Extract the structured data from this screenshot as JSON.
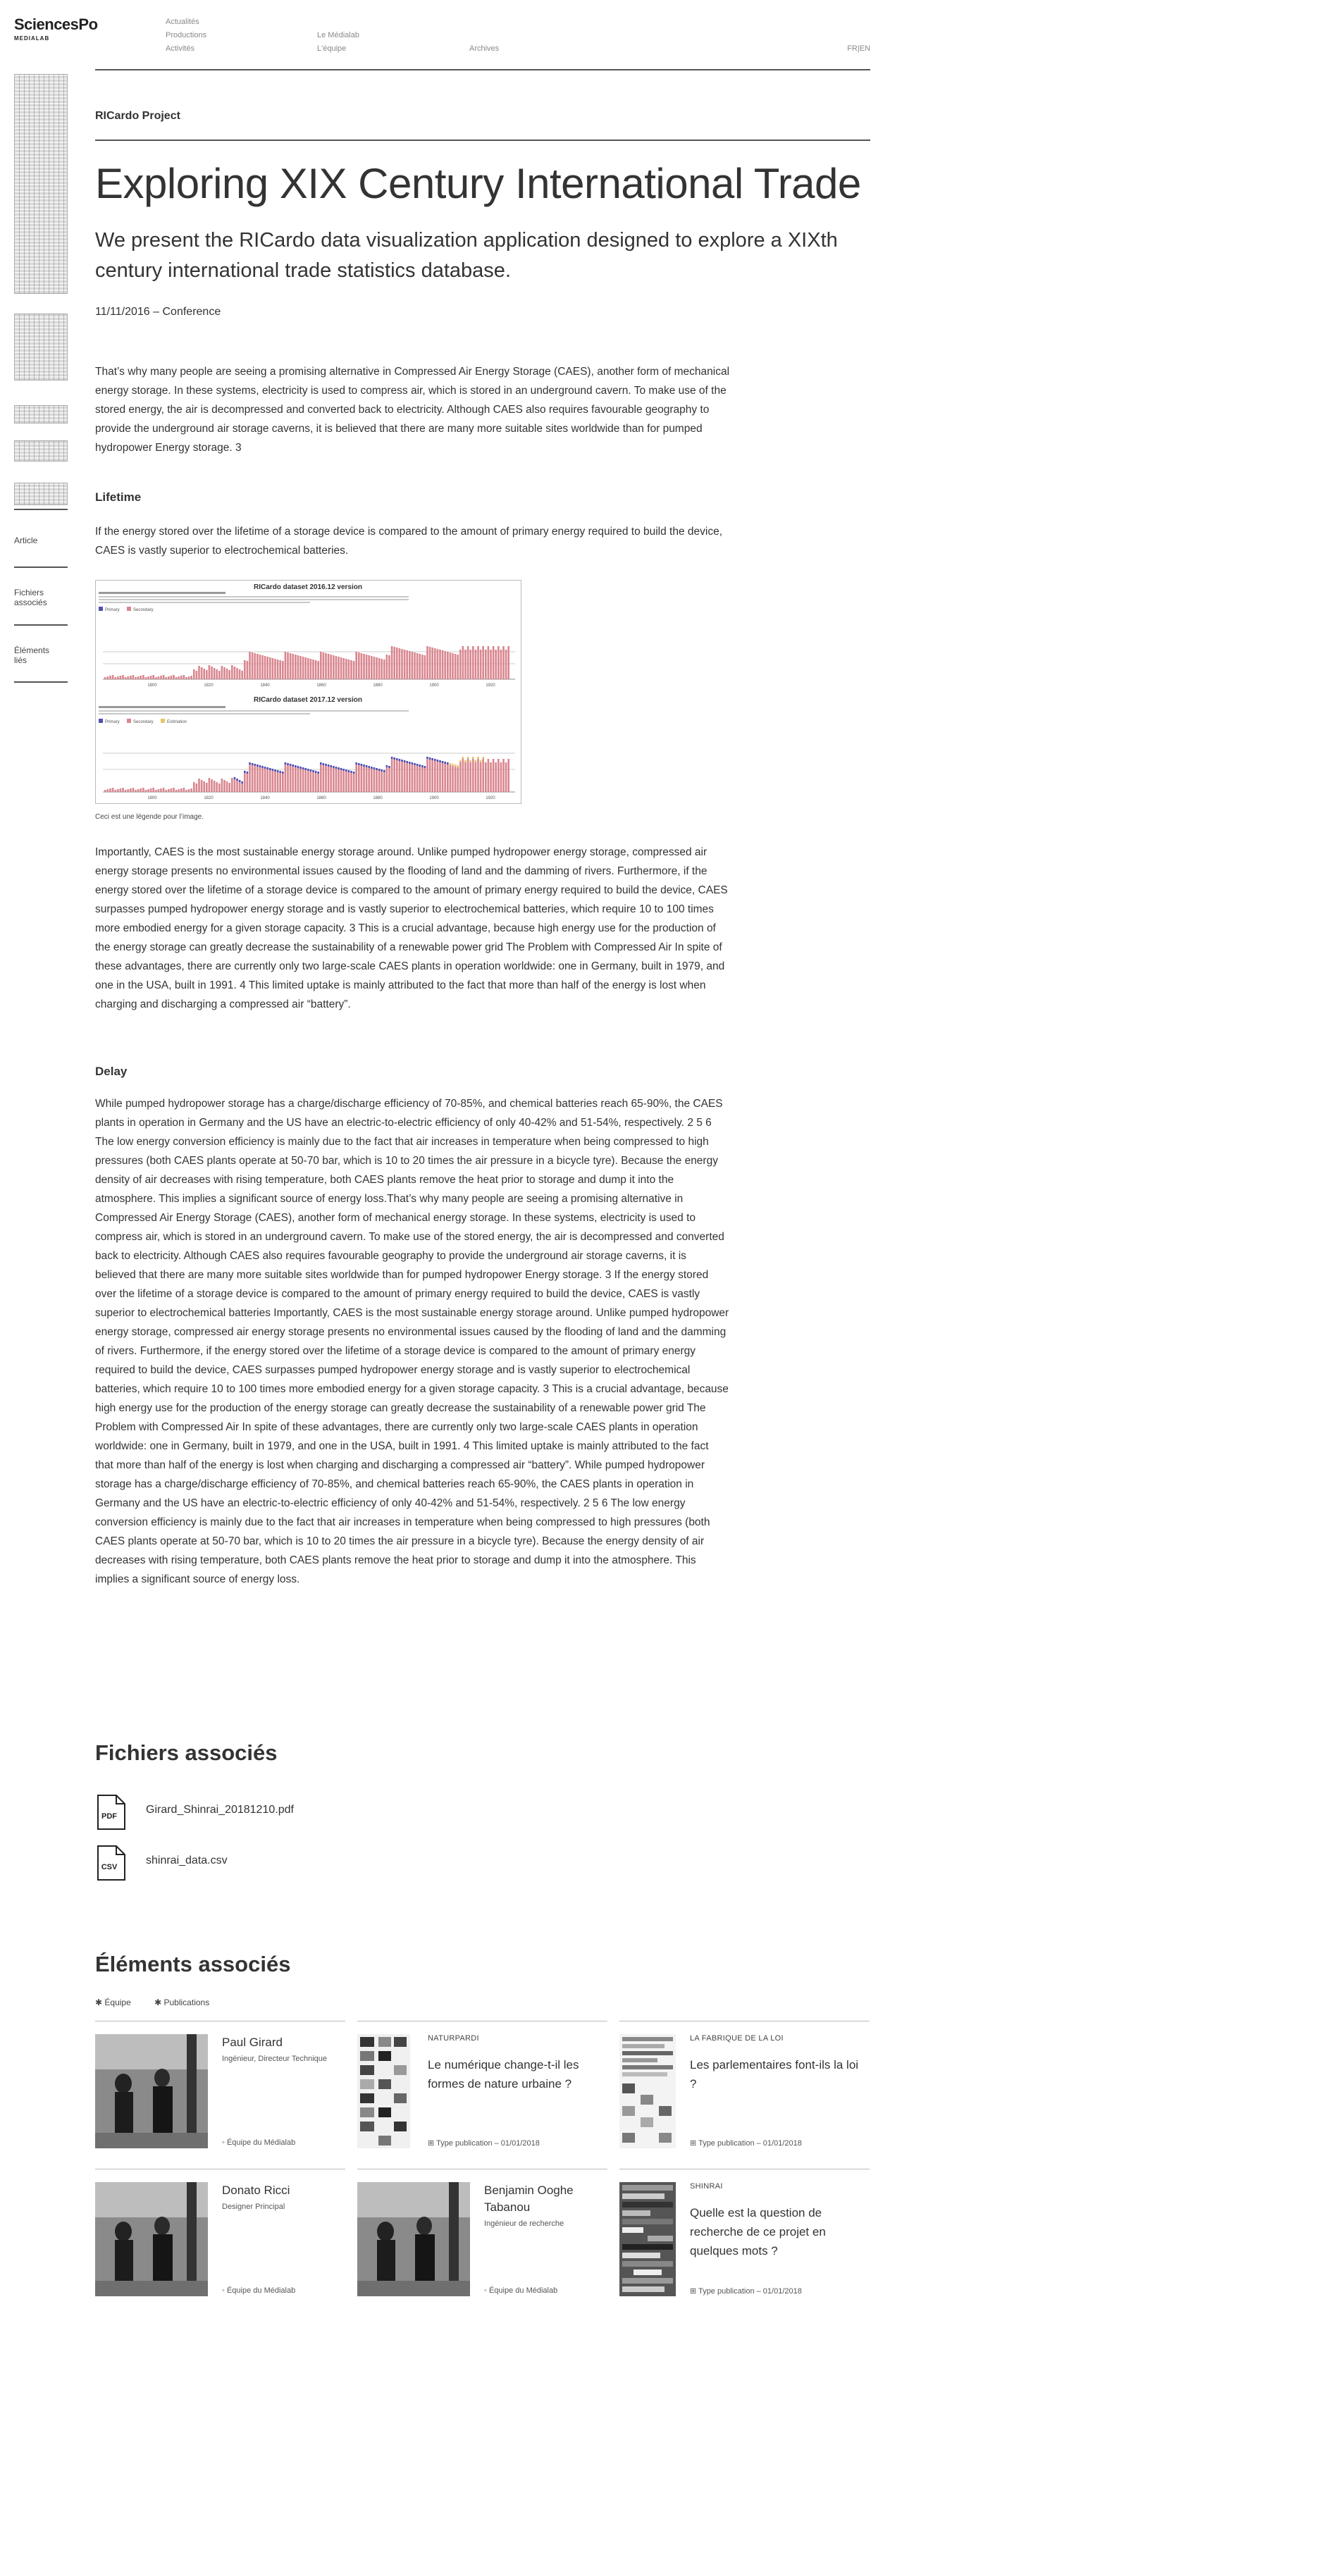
{
  "header": {
    "logo_main": "SciencesPo",
    "logo_sub": "MEDIALAB",
    "nav": [
      "Actualités",
      "Productions",
      "Activités",
      "Le Médialab",
      "L'équipe",
      "Archives"
    ],
    "lang": "FR|EN"
  },
  "sidebar": {
    "links": [
      "Article",
      "Fichiers associés",
      "Éléments liés"
    ]
  },
  "article": {
    "project": "RICardo Project",
    "title": "Exploring XIX Century International Trade",
    "subtitle": "We present the RICardo data visualization application designed to explore a XIXth century international trade statistics database.",
    "meta": "11/11/2016 – Conference",
    "intro": "That’s why many people are seeing a promising alternative in Compressed Air Energy Storage (CAES), another form of mechanical energy storage. In these systems, electricity is used to compress air, which is stored in an underground cavern. To make use of the stored energy, the air is decompressed and converted back to electricity. Although CAES also requires favourable geography to provide the underground air storage caverns, it is believed that there are many more suitable sites worldwide than for pumped hydropower Energy storage. 3",
    "lifetime_heading": "Lifetime",
    "lifetime_text": "If the energy stored over the lifetime of a storage device is compared to the amount of primary energy required to build the device, CAES is vastly superior to electrochemical batteries.",
    "figure": {
      "chart1_title": "RICardo dataset 2016.12 version",
      "chart2_title": "RICardo dataset 2017.12 version",
      "legend1": [
        "Primary",
        "Secondary"
      ],
      "legend2": [
        "Primary",
        "Secondary",
        "Estimation"
      ],
      "axis_years": [
        "1800",
        "1820",
        "1840",
        "1860",
        "1880",
        "1900",
        "1920"
      ],
      "caption": "Ceci est une légende pour l’image."
    },
    "para2": "Importantly, CAES is the most sustainable energy storage around. Unlike pumped hydropower energy storage, compressed air energy storage presents no environmental issues caused by the flooding of land and the damming of rivers. Furthermore, if the energy stored over the lifetime of a storage device is compared to the amount of primary energy required to build the device, CAES surpasses pumped hydropower energy storage and is vastly superior to electrochemical batteries, which require 10 to 100 times more embodied energy for a given storage capacity. 3 This is a crucial advantage, because high energy use for the production of the energy storage can greatly decrease the sustainability of a renewable power grid The Problem with Compressed Air In spite of these advantages, there are currently only two large-scale CAES plants in operation worldwide: one in Germany, built in 1979, and one in the USA, built in 1991. 4 This limited uptake is mainly attributed to the fact that more than half of the energy is lost when charging and discharging a compressed air “battery”.",
    "delay_heading": "Delay",
    "delay_text": "While pumped hydropower storage has a charge/discharge efficiency of 70-85%, and chemical batteries reach 65-90%, the CAES plants in operation in Germany and the US have an electric-to-electric efficiency of only 40-42% and 51-54%, respectively. 2 5 6 The low energy conversion efficiency is mainly due to the fact that air increases in temperature when being compressed to high pressures (both CAES plants operate at 50-70 bar, which is 10 to 20 times the air pressure in a bicycle tyre). Because the energy density of air decreases with rising temperature, both CAES plants remove the heat prior to storage and dump it into the atmosphere. This implies a significant source of energy loss.That’s why many people are seeing a promising alternative in Compressed Air Energy Storage (CAES), another form of mechanical energy storage. In these systems, electricity is used to compress air, which is stored in an underground cavern. To make use of the stored energy, the air is decompressed and converted back to electricity. Although CAES also requires favourable geography to provide the underground air storage caverns, it is believed that there are many more suitable sites worldwide than for pumped hydropower Energy storage. 3 If the energy stored over the lifetime of a storage device is compared to the amount of primary energy required to build the device, CAES is vastly superior to electrochemical batteries Importantly, CAES is the most sustainable energy storage around. Unlike pumped hydropower energy storage, compressed air energy storage presents no environmental issues caused by the flooding of land and the damming of rivers. Furthermore, if the energy stored over the lifetime of a storage device is compared to the amount of primary energy required to build the device, CAES surpasses pumped hydropower energy storage and is vastly superior to electrochemical batteries, which require 10 to 100 times more embodied energy for a given storage capacity. 3 This is a crucial advantage, because high energy use for the production of the energy storage can greatly decrease the sustainability of a renewable power grid The Problem with Compressed Air In spite of these advantages, there are currently only two large-scale CAES plants in operation worldwide: one in Germany, built in 1979, and one in the USA, built in 1991. 4 This limited uptake is mainly attributed to the fact that more than half of the energy is lost when charging and discharging a compressed air “battery”. While pumped hydropower storage has a charge/discharge efficiency of 70-85%, and chemical batteries reach 65-90%, the CAES plants in operation in Germany and the US have an electric-to-electric efficiency of only 40-42% and 51-54%, respectively. 2 5 6 The low energy conversion efficiency is mainly due to the fact that air increases in temperature when being compressed to high pressures (both CAES plants operate at 50-70 bar, which is 10 to 20 times the air pressure in a bicycle tyre). Because the energy density of air decreases with rising temperature, both CAES plants remove the heat prior to storage and dump it into the atmosphere. This implies a significant source of energy loss."
  },
  "files": {
    "heading": "Fichiers associés",
    "items": [
      {
        "type": "PDF",
        "name": "Girard_Shinrai_20181210.pdf"
      },
      {
        "type": "CSV",
        "name": "shinrai_data.csv"
      }
    ]
  },
  "related": {
    "heading": "Éléments associés",
    "filters": [
      "Équipe",
      "Publications"
    ],
    "cards": [
      {
        "kind": "person",
        "name": "Paul Girard",
        "role": "Ingénieur, Directeur Technique",
        "foot": "Équipe du Médialab"
      },
      {
        "kind": "pub",
        "kicker": "NATURPARDI",
        "title": "Le numérique change-t-il les formes de nature urbaine ?",
        "foot": "Type publication – 01/01/2018"
      },
      {
        "kind": "pub",
        "kicker": "LA FABRIQUE DE LA LOI",
        "title": "Les parlementaires font-ils la loi ?",
        "foot": "Type publication – 01/01/2018"
      },
      {
        "kind": "person",
        "name": "Donato Ricci",
        "role": "Designer Principal",
        "foot": "Équipe du Médialab"
      },
      {
        "kind": "person",
        "name": "Benjamin Ooghe Tabanou",
        "role": "Ingénieur de recherche",
        "foot": "Équipe du Médialab"
      },
      {
        "kind": "pub",
        "kicker": "SHINRAI",
        "title": "Quelle est la question de recherche de ce projet en quelques mots ?",
        "foot": "Type publication – 01/01/2018"
      }
    ]
  },
  "colors": {
    "text": "#333333",
    "rule": "#555555",
    "chart_primary": "#d9868f",
    "chart_secondary": "#4f4fb0",
    "chart_estimation": "#e8c46a"
  }
}
